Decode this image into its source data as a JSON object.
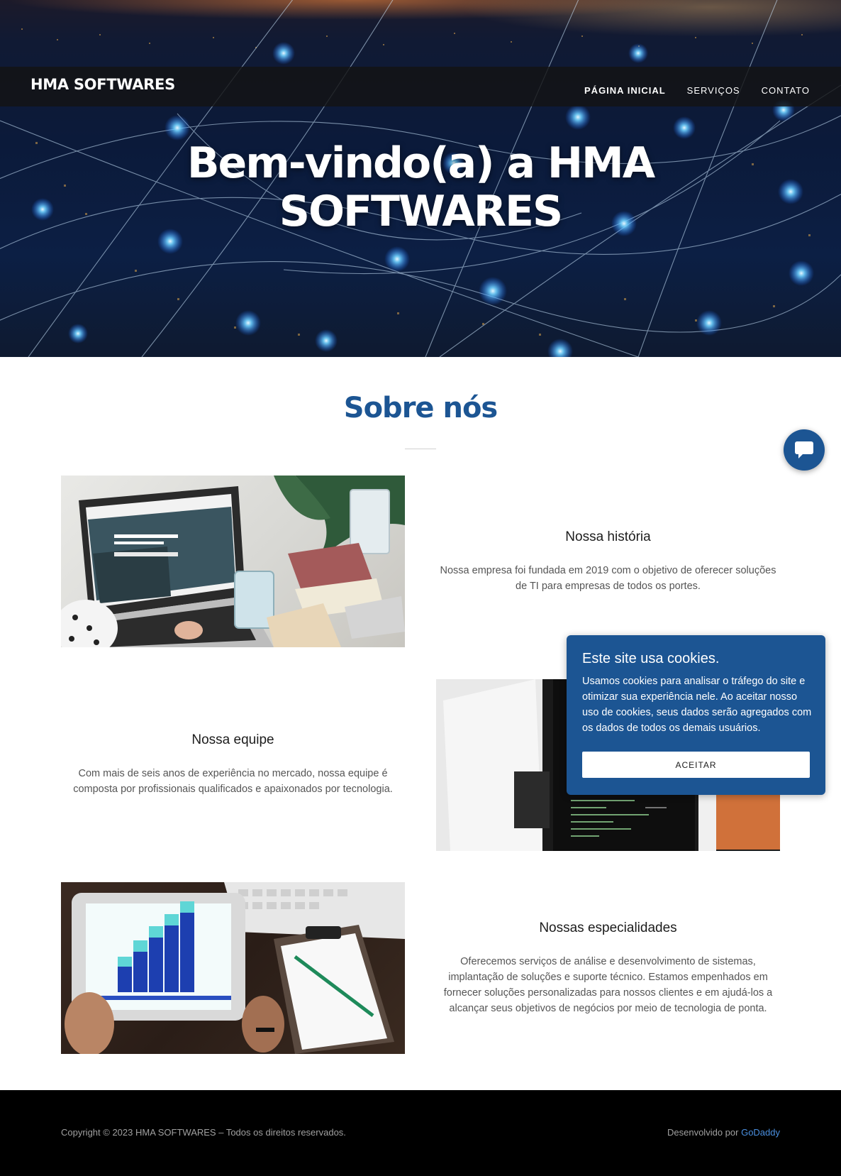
{
  "header": {
    "logo": "HMA SOFTWARES",
    "nav": [
      {
        "label": "PÁGINA INICIAL",
        "active": true
      },
      {
        "label": "SERVIÇOS",
        "active": false
      },
      {
        "label": "CONTATO",
        "active": false
      }
    ]
  },
  "hero": {
    "title_line1": "Bem-vindo(a) a HMA",
    "title_line2": "SOFTWARES"
  },
  "about": {
    "title": "Sobre nós",
    "items": [
      {
        "heading": "Nossa história",
        "text": "Nossa empresa foi fundada em 2019 com o objetivo de oferecer soluções de TI para empresas de todos os portes."
      },
      {
        "heading": "Nossa equipe",
        "text": "Com mais de seis anos de experiência no mercado, nossa equipe é composta por profissionais qualificados e apaixonados por tecnologia."
      },
      {
        "heading": "Nossas especialidades",
        "text": "Oferecemos serviços de análise e desenvolvimento de sistemas, implantação de soluções e suporte técnico. Estamos empenhados em fornecer soluções personalizadas para nossos clientes e em ajudá-los a alcançar seus objetivos de negócios por meio de tecnologia de ponta."
      }
    ]
  },
  "cookie": {
    "title": "Este site usa cookies.",
    "text": "Usamos cookies para analisar o tráfego do site e otimizar sua experiência nele. Ao aceitar nosso uso de cookies, seus dados serão agregados com os dados de todos os demais usuários.",
    "button": "ACEITAR"
  },
  "footer": {
    "copyright": "Copyright © 2023 HMA SOFTWARES – Todos os direitos reservados.",
    "developed_by": "Desenvolvido por",
    "developer_link": "GoDaddy"
  },
  "colors": {
    "brand_blue": "#1c5593",
    "link_blue": "#4a8fe0"
  },
  "icons": {
    "chat": "chat-bubble-icon"
  }
}
